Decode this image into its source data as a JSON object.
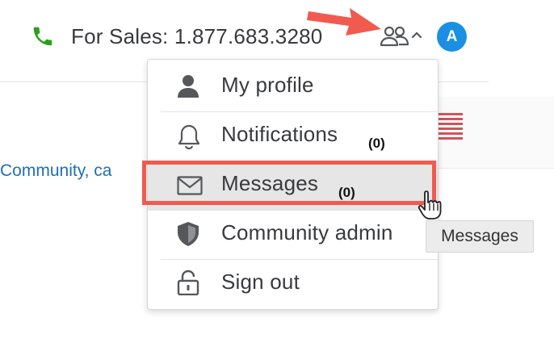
{
  "header": {
    "sales_text": "For Sales: 1.877.683.3280",
    "avatar_initial": "A",
    "icons": {
      "phone": "phone-icon",
      "community": "community-icon",
      "caret": "chevron-up-icon"
    }
  },
  "background": {
    "community_link_text": "Community, ca"
  },
  "menu": {
    "items": [
      {
        "label": "My profile",
        "icon": "user-icon"
      },
      {
        "label": "Notifications",
        "count": "(0)",
        "icon": "bell-icon"
      },
      {
        "label": "Messages",
        "count": "(0)",
        "icon": "envelope-icon"
      },
      {
        "label": "Community admin",
        "icon": "shield-icon"
      },
      {
        "label": "Sign out",
        "icon": "lock-icon"
      }
    ]
  },
  "tooltip": {
    "text": "Messages"
  },
  "colors": {
    "accent_red": "#f05a4f",
    "avatar_blue": "#1b90e3",
    "phone_green": "#2ca01c",
    "link_blue": "#1f6fb5"
  }
}
